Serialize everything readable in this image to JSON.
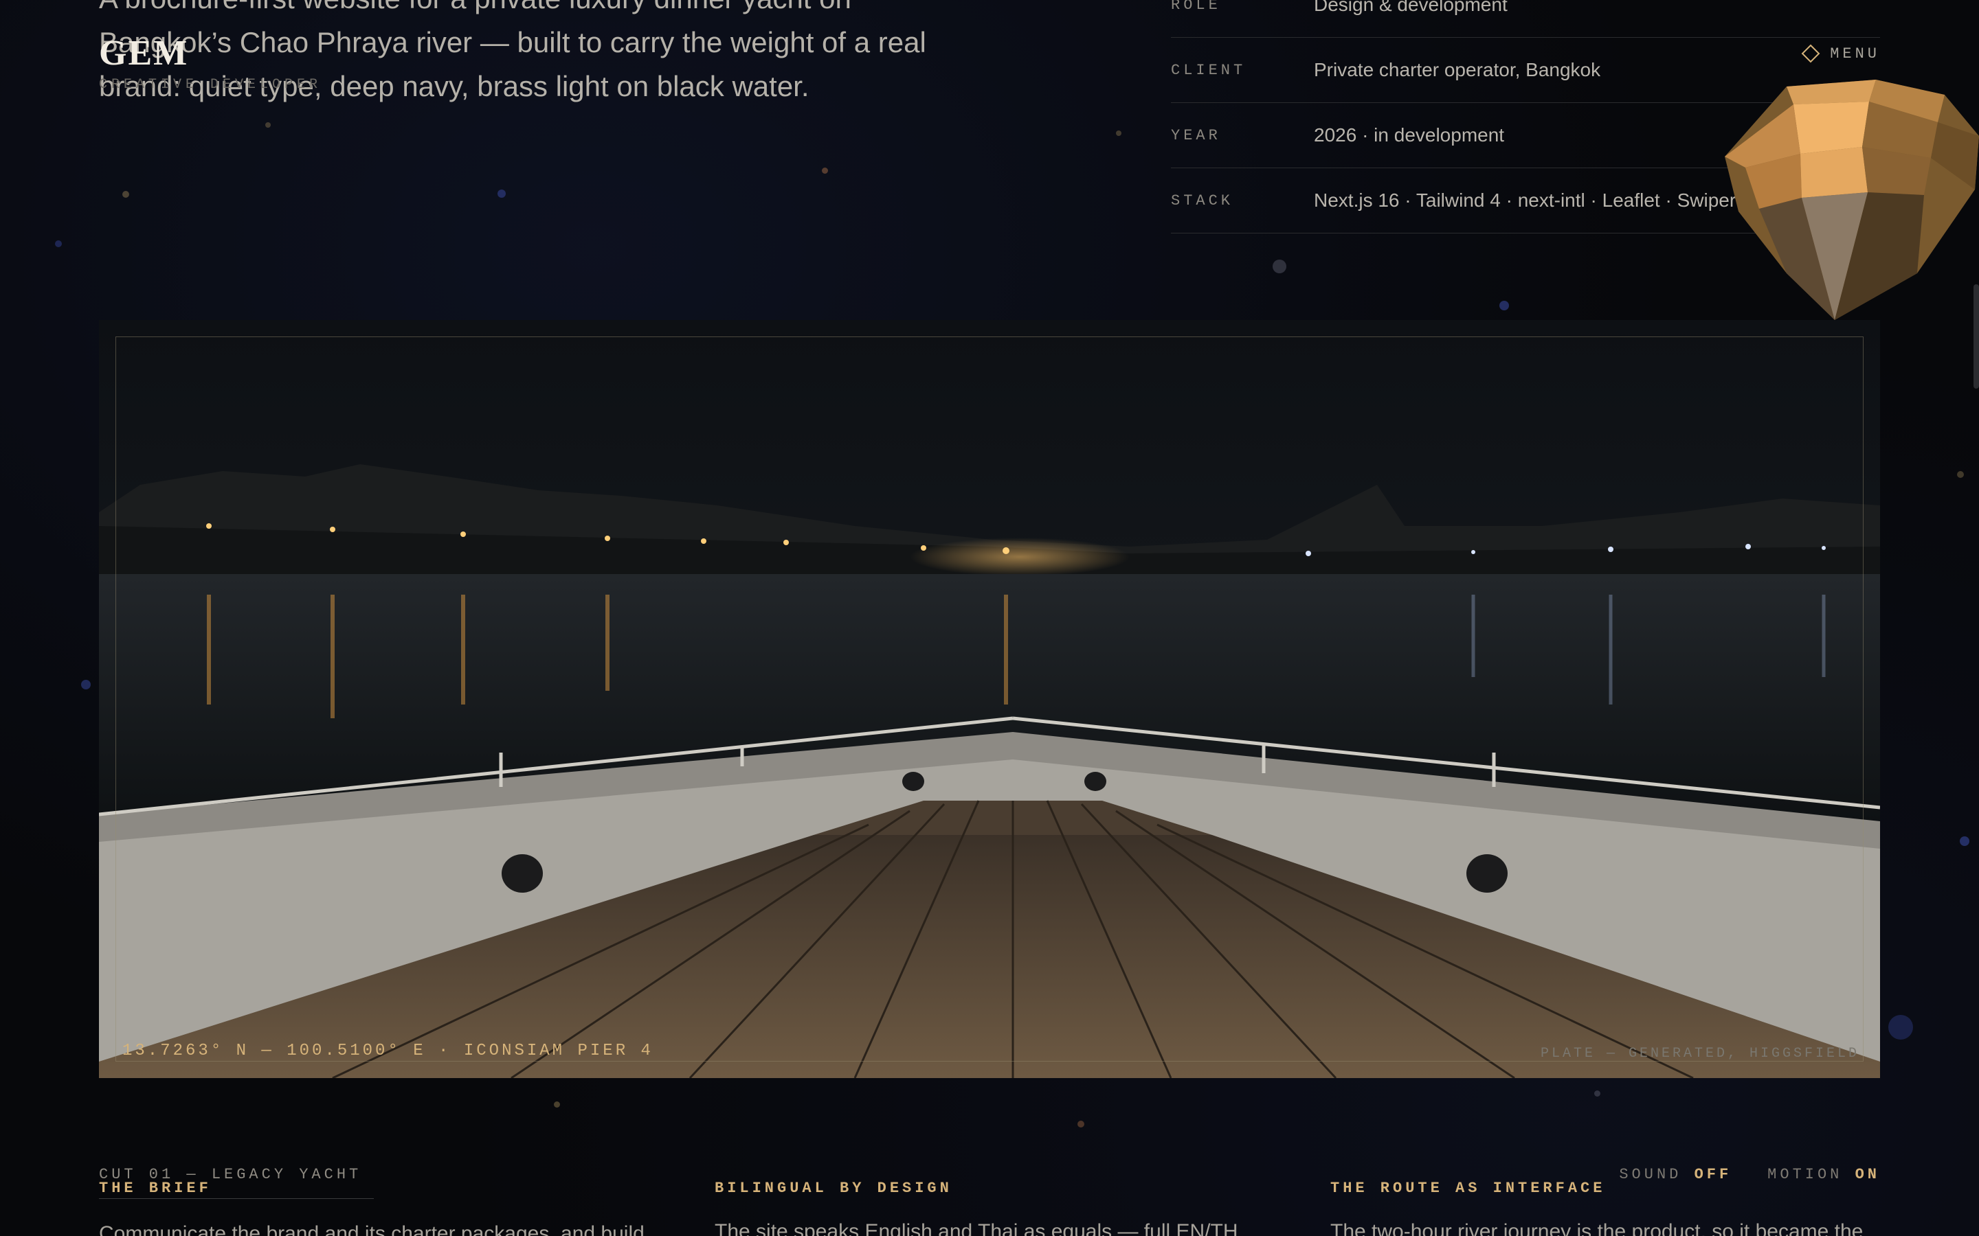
{
  "intro": {
    "line1": "A brochure-first website for a private luxury dinner yacht on",
    "line2": "Bangkok’s Chao Phraya river — built to carry the weight of a real",
    "line3": "brand: quiet type, deep navy, brass light on black water."
  },
  "brand": {
    "logo": "GEM",
    "subtitle": "Creative developer"
  },
  "meta": [
    {
      "key": "Role",
      "value": "Design & development"
    },
    {
      "key": "Client",
      "value": "Private charter operator, Bangkok"
    },
    {
      "key": "Year",
      "value": "2026 · in development"
    },
    {
      "key": "Stack",
      "value": "Next.js 16 · Tailwind 4 · next-intl · Leaflet · Swiper"
    }
  ],
  "menu": {
    "label": "MENU",
    "icon": "diamond-icon"
  },
  "hero": {
    "coords": "13.7263° N — 100.5100° E · ICONSIAM PIER 4",
    "credit": "PLATE — GENERATED, HIGGSFIELD"
  },
  "cut_label": "CUT 01 — LEGACY YACHT",
  "columns": [
    {
      "title": "THE BRIEF",
      "body": "Communicate the brand and its charter packages, and build"
    },
    {
      "title": "BILINGUAL BY DESIGN",
      "body": "The site speaks English and Thai as equals — full EN/TH"
    },
    {
      "title": "THE ROUTE AS INTERFACE",
      "body": "The two-hour river journey is the product, so it became the"
    }
  ],
  "toggles": {
    "sound_label": "SOUND",
    "sound_state": "OFF",
    "motion_label": "MOTION",
    "motion_state": "ON"
  },
  "colors": {
    "accent": "#d6b37a",
    "background": "#07080b",
    "text": "#c7c3ba"
  }
}
